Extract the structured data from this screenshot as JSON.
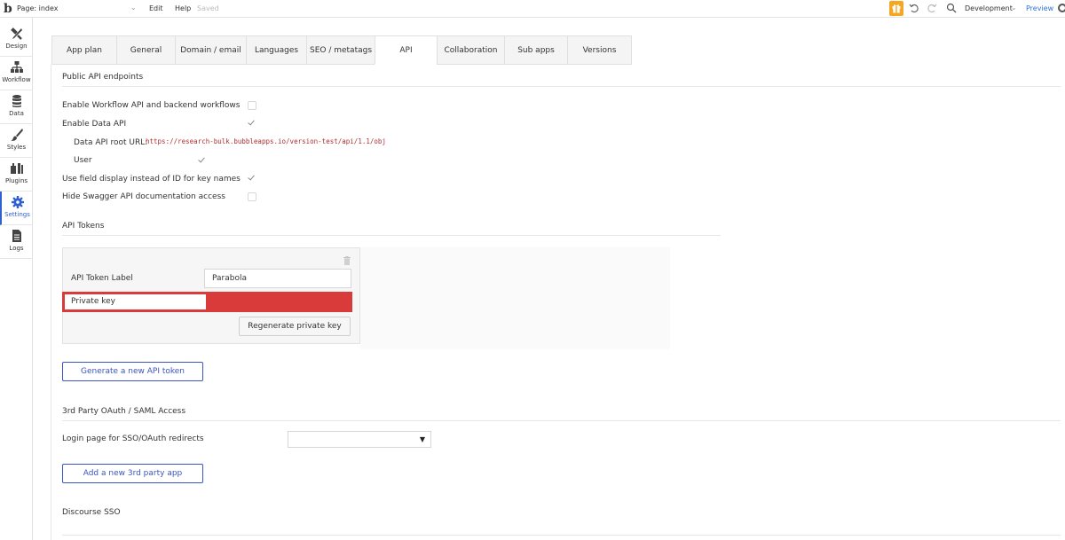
{
  "topbar": {
    "logo": "b",
    "page_label": "Page: index",
    "menu_edit": "Edit",
    "menu_help": "Help",
    "saved": "Saved",
    "environment": "Development",
    "preview": "Preview"
  },
  "sidebar": {
    "items": [
      {
        "label": "Design",
        "icon": "design-icon"
      },
      {
        "label": "Workflow",
        "icon": "workflow-icon"
      },
      {
        "label": "Data",
        "icon": "database-icon"
      },
      {
        "label": "Styles",
        "icon": "brush-icon"
      },
      {
        "label": "Plugins",
        "icon": "plugin-icon"
      },
      {
        "label": "Settings",
        "icon": "gear-icon",
        "active": true
      },
      {
        "label": "Logs",
        "icon": "document-icon"
      }
    ],
    "active_color": "#2f5fd0"
  },
  "tabs": [
    {
      "label": "App plan"
    },
    {
      "label": "General"
    },
    {
      "label": "Domain / email"
    },
    {
      "label": "Languages"
    },
    {
      "label": "SEO / metatags"
    },
    {
      "label": "API",
      "active": true
    },
    {
      "label": "Collaboration"
    },
    {
      "label": "Sub apps"
    },
    {
      "label": "Versions"
    }
  ],
  "public_api": {
    "title": "Public API endpoints",
    "enable_workflow": {
      "label": "Enable Workflow API and backend workflows",
      "checked": false
    },
    "enable_data": {
      "label": "Enable Data API",
      "checked": true
    },
    "root_url_label": "Data API root URL:",
    "root_url": "https://research-bulk.bubbleapps.io/version-test/api/1.1/obj",
    "user": {
      "label": "User",
      "checked": true
    },
    "field_display": {
      "label": "Use field display instead of ID for key names",
      "checked": true
    },
    "hide_swagger": {
      "label": "Hide Swagger API documentation access",
      "checked": false
    }
  },
  "api_tokens": {
    "title": "API Tokens",
    "token_label_label": "API Token Label",
    "token_label_value": "Parabola",
    "private_key_label": "Private key",
    "regenerate_button": "Regenerate private key",
    "generate_button": "Generate a new API token",
    "redacted_color": "#d93a3a"
  },
  "oauth": {
    "title": "3rd Party OAuth / SAML Access",
    "login_page_label": "Login page for SSO/OAuth redirects",
    "login_page_value": "",
    "add_app_button": "Add a new 3rd party app"
  },
  "discourse": {
    "title": "Discourse SSO"
  },
  "accent_color": "#3a55c6",
  "gift_color": "#f5a623"
}
